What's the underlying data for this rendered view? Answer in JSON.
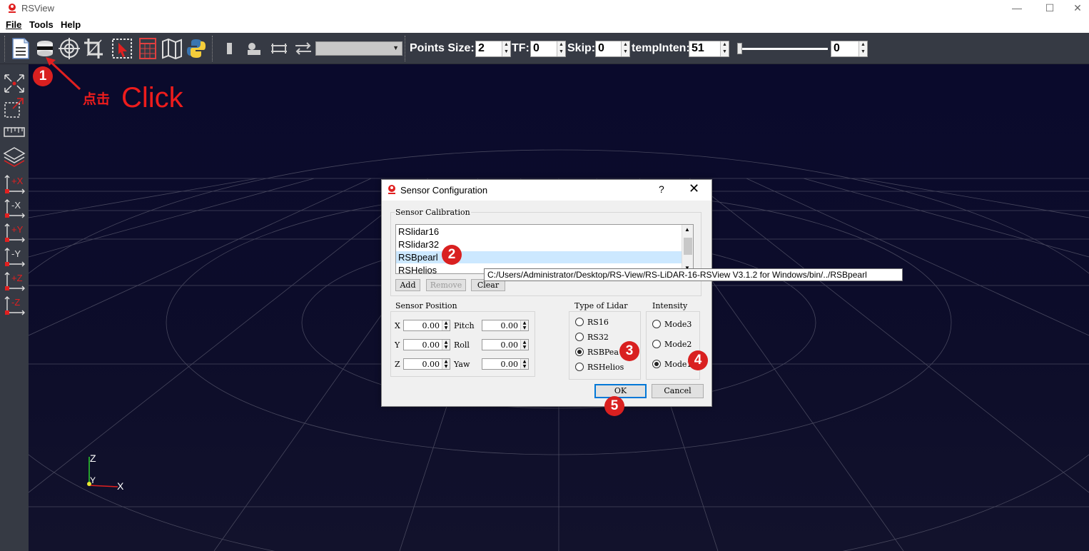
{
  "window": {
    "title": "RSView",
    "minimize": "—",
    "maximize": "☐",
    "close": "✕"
  },
  "menu": {
    "items": [
      "File",
      "Tools",
      "Help"
    ]
  },
  "toolbar": {
    "icons": [
      "open-file",
      "lidar-sensor",
      "target",
      "crop",
      "select",
      "spreadsheet",
      "map",
      "python"
    ],
    "icons2": [
      "vertical-bar",
      "shapes",
      "arrows",
      "swap-arrows"
    ],
    "points_size_label": "Points Size:",
    "points_size_value": "2",
    "tf_label": "TF:",
    "tf_value": "0",
    "skip_label": "Skip:",
    "skip_value": "0",
    "tempinten_label": "tempInten:",
    "tempinten_value": "51",
    "slider_value": "0"
  },
  "left_toolbar": {
    "axes": [
      "+X",
      "-X",
      "+Y",
      "-Y",
      "+Z",
      "-Z"
    ]
  },
  "annotations": {
    "badge1": "1",
    "badge2": "2",
    "badge3": "3",
    "badge4": "4",
    "badge5": "5",
    "click_cn": "点击",
    "click_en": "Click"
  },
  "axes_widget": {
    "z": "Z",
    "y": "Y",
    "x": "X"
  },
  "dialog": {
    "title": "Sensor Configuration",
    "help": "?",
    "close": "✕",
    "calibration_title": "Sensor Calibration",
    "calibration_items": [
      "RSlidar16",
      "RSlidar32",
      "RSBpearl",
      "RSHelios"
    ],
    "add": "Add",
    "remove": "Remove",
    "clear": "Clear",
    "position_title": "Sensor Position",
    "x_label": "X",
    "x_value": "0.00",
    "y_label": "Y",
    "y_value": "0.00",
    "z_label": "Z",
    "z_value": "0.00",
    "pitch_label": "Pitch",
    "pitch_value": "0.00",
    "roll_label": "Roll",
    "roll_value": "0.00",
    "yaw_label": "Yaw",
    "yaw_value": "0.00",
    "lidar_title": "Type of Lidar",
    "lidar_options": [
      "RS16",
      "RS32",
      "RSBPearl",
      "RSHelios"
    ],
    "intensity_title": "Intensity",
    "intensity_options": [
      "Mode3",
      "Mode2",
      "Mode1"
    ],
    "ok": "OK",
    "cancel": "Cancel"
  },
  "tooltip": "C:/Users/Administrator/Desktop/RS-View/RS-LiDAR-16-RSView V3.1.2 for Windows/bin/../RSBpearl"
}
